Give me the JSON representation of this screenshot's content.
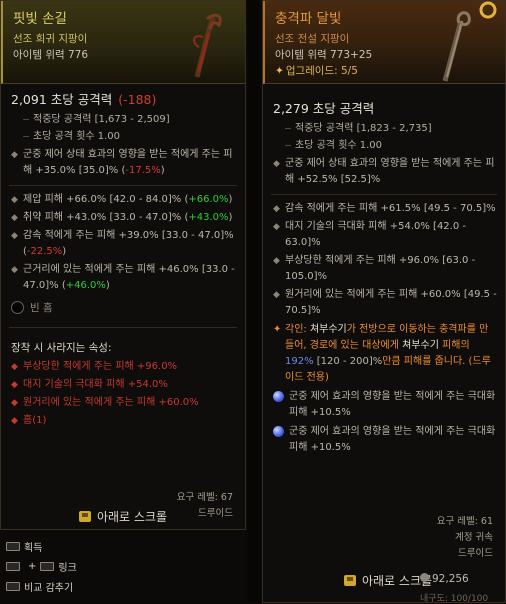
{
  "left": {
    "name": "핏빛 손길",
    "rarity": "선조 희귀 지팡이",
    "item_power": "아이템 위력 776",
    "dps": "2,091 초당 공격력",
    "dps_diff": "(-188)",
    "damage_per_hit": "적중당 공격력 [1,673 - 2,509]",
    "attacks_per_sec": "초당 공격 횟수 1.00",
    "implicit": {
      "text": "군중 제어 상태 효과의 영향을 받는 적에게 주는 피해 +35.0% [35.0]% (",
      "diff": "-17.5%",
      "close": ")"
    },
    "affixes": [
      {
        "text": "제압 피해 +66.0% [42.0 - 84.0]% (",
        "diff": "+66.0%",
        "close": ")",
        "color": "green"
      },
      {
        "text": "취약 피해 +43.0% [33.0 - 47.0]% (",
        "diff": "+43.0%",
        "close": ")",
        "color": "green"
      },
      {
        "text": "감속 적에게 주는 피해 +39.0% [33.0 - 47.0]% (",
        "diff": "-22.5%",
        "close": ")",
        "color": "red"
      },
      {
        "text": "근거리에 있는 적에게 주는 피해 +46.0% [33.0 - 47.0]% (",
        "diff": "+46.0%",
        "close": ")",
        "color": "green"
      }
    ],
    "socket": "빈 홈",
    "lost_title": "장착 시 사라지는 속성:",
    "lost": [
      "부상당한 적에게 주는 피해 +96.0%",
      "대지 기술의 극대화 피해 +54.0%",
      "원거리에 있는 적에게 주는 피해 +60.0%",
      "홈(1)"
    ],
    "req_level": "요구 레벨: 67",
    "class": "드루이드",
    "scroll": "아래로 스크롤"
  },
  "right": {
    "name": "충격파 달빛",
    "rarity": "선조 전설 지팡이",
    "item_power": "아이템 위력 773+25",
    "upgrade": "업그레이드: 5/5",
    "dps": "2,279 초당 공격력",
    "damage_per_hit": "적중당 공격력 [1,823 - 2,735]",
    "attacks_per_sec": "초당 공격 횟수 1.00",
    "implicit": "군중 제어 상태 효과의 영향을 받는 적에게 주는 피해 +52.5% [52.5]%",
    "affixes": [
      "감속 적에게 주는 피해 +61.5% [49.5 - 70.5]%",
      "대지 기술의 극대화 피해 +54.0% [42.0 - 63.0]%",
      "부상당한 적에게 주는 피해 +96.0% [63.0 - 105.0]%",
      "원거리에 있는 적에게 주는 피해 +60.0% [49.5 - 70.5]%"
    ],
    "legendary": {
      "prefix": "각인: ",
      "skill": "쳐부수기",
      "a": "가 전방으로 이동하는 충격파를 만들어, 경로에 있는 대상에게 ",
      "skill2": "쳐부수기",
      "b": " 피해의 ",
      "pct": "192%",
      "c": " [120 - 200]%",
      "d": "만큼 피해를 줍니다. (드루이드 전용)"
    },
    "gems": [
      "군중 제어 효과의 영향을 받는 적에게 주는 극대화 피해 +10.5%",
      "군중 제어 효과의 영향을 받는 적에게 주는 극대화 피해 +10.5%"
    ],
    "req_level": "요구 레벨: 61",
    "account_bound": "계정 귀속",
    "class": "드루이드",
    "scroll": "아래로 스크롤",
    "gold": "92,256",
    "faded": "내구도: 100/100"
  },
  "bottom": {
    "acquire": "획득",
    "link": "링크",
    "compare_hide": "비교 감추기"
  },
  "colors": {
    "unique_yellow": "#d8cf6a",
    "legendary_orange": "#e29745",
    "positive_green": "#30cc38",
    "negative_red": "#d23b30"
  }
}
